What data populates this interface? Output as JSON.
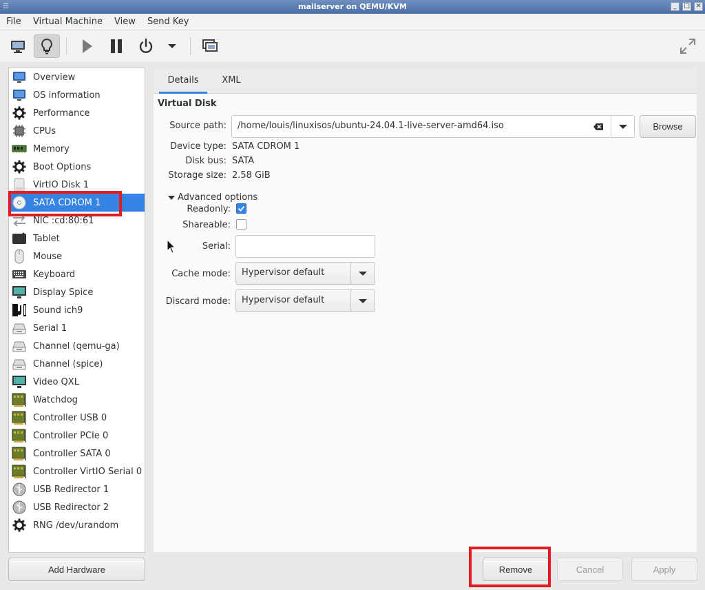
{
  "window": {
    "title": "mailserver on QEMU/KVM"
  },
  "menu": [
    "File",
    "Virtual Machine",
    "View",
    "Send Key"
  ],
  "toolbar": {
    "icons": [
      "monitor-icon",
      "lightbulb-icon",
      "play-icon",
      "pause-icon",
      "power-icon",
      "dropdown-arrow-icon",
      "snapshots-icon",
      "fullscreen-icon"
    ],
    "active": "lightbulb-icon"
  },
  "sidebar": {
    "items": [
      {
        "label": "Overview",
        "icon": "monitor-icon"
      },
      {
        "label": "OS information",
        "icon": "monitor-icon"
      },
      {
        "label": "Performance",
        "icon": "gear-icon"
      },
      {
        "label": "CPUs",
        "icon": "cpu-icon"
      },
      {
        "label": "Memory",
        "icon": "memory-icon"
      },
      {
        "label": "Boot Options",
        "icon": "gear-icon"
      },
      {
        "label": "VirtIO Disk 1",
        "icon": "disk-icon"
      },
      {
        "label": "SATA CDROM 1",
        "icon": "cdrom-icon"
      },
      {
        "label": "NIC :cd:80:61",
        "icon": "network-icon"
      },
      {
        "label": "Tablet",
        "icon": "tablet-icon"
      },
      {
        "label": "Mouse",
        "icon": "mouse-icon"
      },
      {
        "label": "Keyboard",
        "icon": "keyboard-icon"
      },
      {
        "label": "Display Spice",
        "icon": "display-icon"
      },
      {
        "label": "Sound ich9",
        "icon": "sound-icon"
      },
      {
        "label": "Serial 1",
        "icon": "serial-icon"
      },
      {
        "label": "Channel (qemu-ga)",
        "icon": "serial-icon"
      },
      {
        "label": "Channel (spice)",
        "icon": "serial-icon"
      },
      {
        "label": "Video QXL",
        "icon": "display-icon"
      },
      {
        "label": "Watchdog",
        "icon": "card-icon"
      },
      {
        "label": "Controller USB 0",
        "icon": "card-icon"
      },
      {
        "label": "Controller PCIe 0",
        "icon": "card-icon"
      },
      {
        "label": "Controller SATA 0",
        "icon": "card-icon"
      },
      {
        "label": "Controller VirtIO Serial 0",
        "icon": "card-icon"
      },
      {
        "label": "USB Redirector 1",
        "icon": "usb-icon"
      },
      {
        "label": "USB Redirector 2",
        "icon": "usb-icon"
      },
      {
        "label": "RNG /dev/urandom",
        "icon": "gear-icon"
      }
    ],
    "selected": "SATA CDROM 1",
    "add_hardware": "Add Hardware"
  },
  "tabs": [
    {
      "label": "Details",
      "active": true
    },
    {
      "label": "XML",
      "active": false
    }
  ],
  "details": {
    "section_title": "Virtual Disk",
    "source_path_label": "Source path:",
    "source_path": "/home/louis/linuxisos/ubuntu-24.04.1-live-server-amd64.iso",
    "browse": "Browse",
    "device_type_label": "Device type:",
    "device_type": "SATA CDROM 1",
    "disk_bus_label": "Disk bus:",
    "disk_bus": "SATA",
    "storage_size_label": "Storage size:",
    "storage_size": "2.58 GiB",
    "advanced_label": "Advanced options",
    "readonly_label": "Readonly:",
    "readonly": true,
    "shareable_label": "Shareable:",
    "shareable": false,
    "serial_label": "Serial:",
    "serial": "",
    "cache_mode_label": "Cache mode:",
    "cache_mode": "Hypervisor default",
    "discard_mode_label": "Discard mode:",
    "discard_mode": "Hypervisor default"
  },
  "buttons": {
    "remove": "Remove",
    "cancel": "Cancel",
    "apply": "Apply"
  },
  "colors": {
    "selection": "#3584e4",
    "highlight": "#e01b24",
    "titlebar": "#5b7db3"
  }
}
